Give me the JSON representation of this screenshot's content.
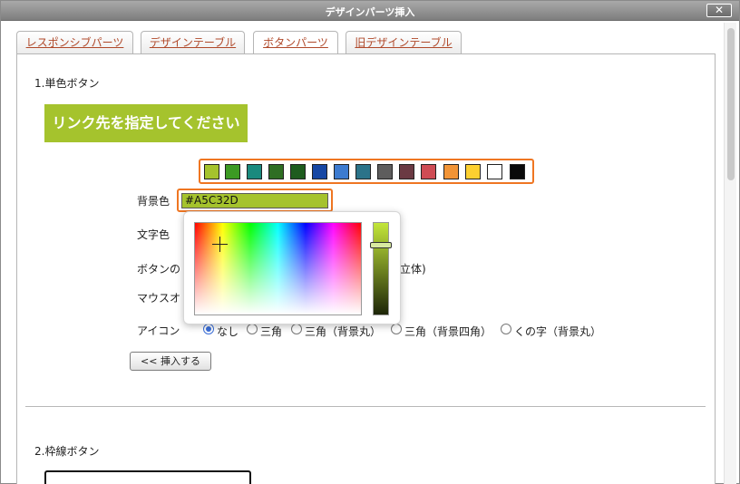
{
  "window": {
    "title": "デザインパーツ挿入",
    "close_label": "✕"
  },
  "tabs": [
    {
      "label": "レスポンシブパーツ"
    },
    {
      "label": "デザインテーブル"
    },
    {
      "label": "ボタンパーツ"
    },
    {
      "label": "旧デザインテーブル"
    }
  ],
  "active_tab": "ボタンパーツ",
  "section1": {
    "title": "1.単色ボタン",
    "preview_text": "リンク先を指定してください",
    "preview_bg": "#A5C32D",
    "swatches": [
      "#A5C32D",
      "#3c9a23",
      "#1a8a7e",
      "#2f6e23",
      "#1e5c1e",
      "#1647a4",
      "#3c7bd0",
      "#2b7389",
      "#5e5d5d",
      "#6b3a43",
      "#cf4c54",
      "#f29436",
      "#fdd030",
      "#ffffff",
      "#0a0a0a"
    ],
    "bg_label": "背景色",
    "bg_value": "#A5C32D",
    "text_label": "文字色",
    "shape_label": "ボタンの",
    "shape_suffix": "立体)",
    "mouse_label": "マウスオ",
    "icon_label": "アイコン",
    "icon_options": [
      "なし",
      "三角",
      "三角（背景丸）",
      "三角（背景四角）",
      "くの字（背景丸）"
    ],
    "icon_selected": "なし",
    "insert_label": "<< 挿入する"
  },
  "section2": {
    "title": "2.枠線ボタン"
  },
  "colors": {
    "accent_orange": "#ef7622",
    "tab_link": "#b0492a"
  }
}
